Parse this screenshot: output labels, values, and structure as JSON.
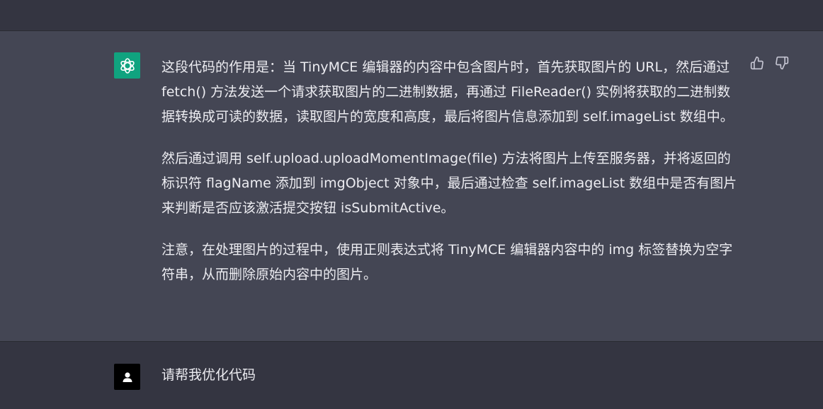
{
  "assistant": {
    "avatar_icon": "openai-logo-icon",
    "avatar_color": "#10a37f",
    "paragraphs": [
      "这段代码的作用是：当 TinyMCE 编辑器的内容中包含图片时，首先获取图片的 URL，然后通过 fetch() 方法发送一个请求获取图片的二进制数据，再通过 FileReader() 实例将获取的二进制数据转换成可读的数据，读取图片的宽度和高度，最后将图片信息添加到 self.imageList 数组中。",
      "然后通过调用 self.upload.uploadMomentImage(file) 方法将图片上传至服务器，并将返回的标识符 flagName 添加到 imgObject 对象中，最后通过检查 self.imageList 数组中是否有图片来判断是否应该激活提交按钮 isSubmitActive。",
      "注意，在处理图片的过程中，使用正则表达式将 TinyMCE 编辑器内容中的 img 标签替换为空字符串，从而删除原始内容中的图片。"
    ],
    "feedback_icons": [
      "thumbs-up-icon",
      "thumbs-down-icon"
    ]
  },
  "user": {
    "avatar_icon": "user-icon",
    "message": "请帮我优化代码"
  }
}
